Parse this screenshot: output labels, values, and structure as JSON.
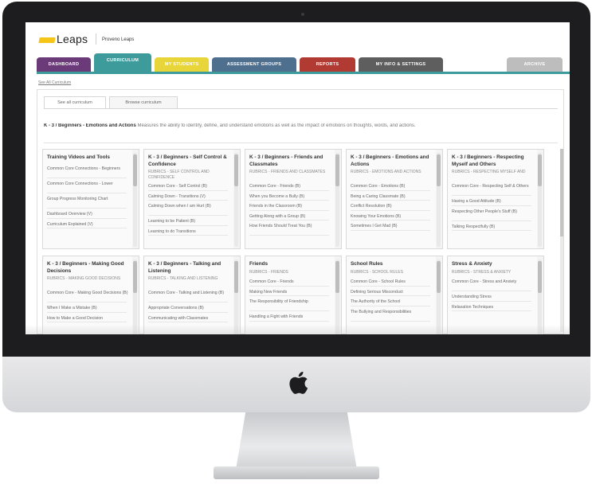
{
  "app": {
    "logo_text": "Leaps",
    "org_name": "Proveno Leaps",
    "logo_color": "#f5c518"
  },
  "tabs": [
    {
      "label": "Dashboard",
      "color": "#6b3a78",
      "active": false
    },
    {
      "label": "Curriculum",
      "color": "#3e9b9b",
      "active": true
    },
    {
      "label": "My Students",
      "color": "#e8d53a",
      "active": false
    },
    {
      "label": "Assessment Groups",
      "color": "#4f6f8f",
      "active": false
    },
    {
      "label": "Reports",
      "color": "#b13a32",
      "active": false
    },
    {
      "label": "My Info & Settings",
      "color": "#5e5e5e",
      "active": false
    },
    {
      "label": "Archive",
      "color": "#bdbdbd",
      "active": false
    }
  ],
  "links": {
    "view_all": "See All Curriculum"
  },
  "view_tabs": [
    {
      "label": "See all curriculum",
      "active": true
    },
    {
      "label": "Browse curriculum",
      "active": false
    }
  ],
  "description": {
    "title": "K - 3 / Beginners - Emotions and Actions",
    "text": "Measures the ability to identify, define, and understand emotions as well as the impact of emotions on thoughts, words, and actions."
  },
  "cards": [
    {
      "title": "Training Videos and Tools",
      "subtitle": "",
      "items": [
        "Common Core Connections - Beginners",
        "Common Core Connections - Lower",
        "Group Progress Monitoring Chart",
        "Dashboard Overview (V)",
        "Curriculum Explained (V)"
      ]
    },
    {
      "title": "K - 3 / Beginners - Self Control & Confidence",
      "subtitle": "Rubrics - Self Control and Confidence",
      "items": [
        "Common Core - Self Control (B)",
        "Calming Down - Transitions (V)",
        "Calming Down when I am Hurt (B)",
        "Learning to be Patient (B)",
        "Learning to do Transitions"
      ]
    },
    {
      "title": "K - 3 / Beginners - Friends and Classmates",
      "subtitle": "Rubrics - Friends and Classmates",
      "items": [
        "Common Core - Friends (B)",
        "When you Become a Bully (B)",
        "Friends in the Classroom (B)",
        "Getting Along with a Group (B)",
        "How Friends Should Treat You (B)"
      ]
    },
    {
      "title": "K - 3 / Beginners - Emotions and Actions",
      "subtitle": "Rubrics - Emotions and Actions",
      "items": [
        "Common Core - Emotions (B)",
        "Being a Caring Classmate (B)",
        "Conflict Resolution (B)",
        "Knowing Your Emotions (B)",
        "Sometimes I Get Mad (B)"
      ]
    },
    {
      "title": "K - 3 / Beginners - Respecting Myself and Others",
      "subtitle": "Rubrics - Respecting Myself and",
      "items": [
        "Common Core - Respecting Self & Others",
        "Having a Good Attitude (B)",
        "Respecting Other People's Stuff (B)",
        "Talking Respectfully (B)"
      ]
    },
    {
      "title": "K - 3 / Beginners - Making Good Decisions",
      "subtitle": "Rubrics - Making Good Decisions",
      "items": [
        "Common Core - Making Good Decisions (B)",
        "When I Make a Mistake (B)",
        "How to Make a Good Decision"
      ]
    },
    {
      "title": "K - 3 / Beginners - Talking and Listening",
      "subtitle": "Rubrics - Talking and Listening",
      "items": [
        "Common Core - Talking and Listening (B)",
        "Appropriate Conversations (B)",
        "Communicating with Classmates"
      ]
    },
    {
      "title": "Friends",
      "subtitle": "Rubrics - Friends",
      "items": [
        "Common Core - Friends",
        "Making New Friends",
        "The Responsibility of Friendship",
        "Handling a Fight with Friends"
      ]
    },
    {
      "title": "School Rules",
      "subtitle": "Rubrics - School Rules",
      "items": [
        "Common Core - School Rules",
        "Defining Serious Misconduct",
        "The Authority of the School",
        "The Bullying and Responsibilities"
      ]
    },
    {
      "title": "Stress & Anxiety",
      "subtitle": "Rubrics - Stress & Anxiety",
      "items": [
        "Common Core - Stress and Anxiety",
        "Understanding Stress",
        "Relaxation Techniques"
      ]
    }
  ]
}
